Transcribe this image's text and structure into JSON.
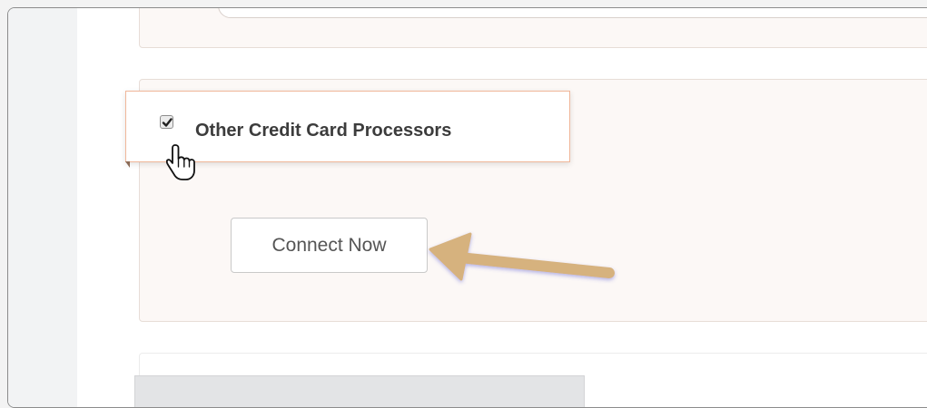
{
  "option": {
    "label": "Other Credit Card Processors",
    "checked": true
  },
  "actions": {
    "connect_label": "Connect Now"
  },
  "colors": {
    "panel_bg": "#fcf8f6",
    "card_border": "#f0b79a",
    "arrow": "#d6b27e"
  },
  "icons": [
    "checkmark-icon",
    "hand-pointer-cursor-icon",
    "annotation-arrow-icon"
  ]
}
